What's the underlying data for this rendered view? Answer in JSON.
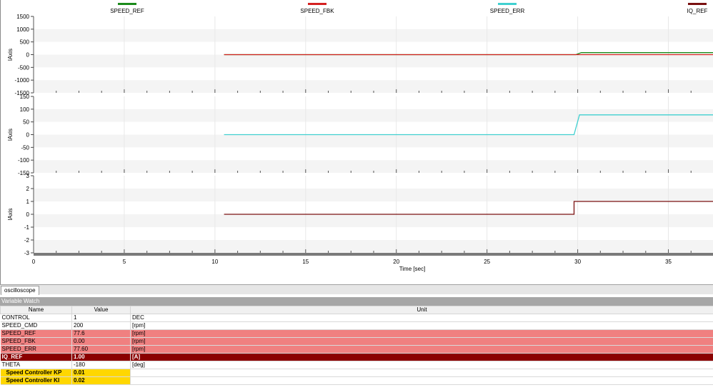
{
  "legend": [
    {
      "name": "SPEED_REF",
      "color": "#1a8a1a"
    },
    {
      "name": "SPEED_FBK",
      "color": "#d42020"
    },
    {
      "name": "SPEED_ERR",
      "color": "#40d0d0"
    },
    {
      "name": "IQ_REF",
      "color": "#7a1010"
    }
  ],
  "chart_data": [
    {
      "type": "line",
      "ylabel": "lAxis",
      "ylim": [
        -1500,
        1500
      ],
      "yticks": [
        "1500",
        "1000",
        "500",
        "0",
        "-500",
        "-1000",
        "-1500"
      ],
      "xlim": [
        0,
        37.5
      ],
      "series": [
        {
          "name": "SPEED_REF",
          "color": "#1a8a1a",
          "x": [
            10.5,
            29.9,
            30.2,
            37.5
          ],
          "y": [
            0,
            0,
            77.6,
            77.6
          ]
        },
        {
          "name": "SPEED_FBK",
          "color": "#d42020",
          "x": [
            10.5,
            37.5
          ],
          "y": [
            0,
            0
          ]
        }
      ]
    },
    {
      "type": "line",
      "ylabel": "lAxis",
      "ylim": [
        -150,
        150
      ],
      "yticks": [
        "150",
        "100",
        "50",
        "0",
        "-50",
        "-100",
        "-150"
      ],
      "xlim": [
        0,
        37.5
      ],
      "series": [
        {
          "name": "SPEED_ERR",
          "color": "#40d0d0",
          "x": [
            10.5,
            29.8,
            30.1,
            37.5
          ],
          "y": [
            0,
            0,
            77.6,
            77.6
          ]
        }
      ]
    },
    {
      "type": "line",
      "ylabel": "lAxis",
      "ylim": [
        -3,
        3
      ],
      "yticks": [
        "3",
        "2",
        "1",
        "0",
        "-1",
        "-2",
        "-3"
      ],
      "xlim": [
        0,
        37.5
      ],
      "xlabel": "Time [sec]",
      "xticks": [
        "0",
        "5",
        "10",
        "15",
        "20",
        "25",
        "30",
        "35"
      ],
      "series": [
        {
          "name": "IQ_REF",
          "color": "#7a1010",
          "x": [
            10.5,
            29.8,
            29.8,
            37.5
          ],
          "y": [
            0,
            0,
            1,
            1
          ]
        }
      ]
    }
  ],
  "tabs": {
    "oscilloscope": "oscilloscope"
  },
  "watch": {
    "title": "Variable Watch",
    "headers": {
      "name": "Name",
      "value": "Value",
      "unit": "Unit"
    },
    "rows": [
      {
        "name": "CONTROL",
        "value": "1",
        "unit": "DEC"
      },
      {
        "name": "SPEED_CMD",
        "value": "200",
        "unit": "[rpm]"
      },
      {
        "name": "SPEED_REF",
        "value": "77.6",
        "unit": "[rpm]"
      },
      {
        "name": "SPEED_FBK",
        "value": "0.00",
        "unit": "[rpm]"
      },
      {
        "name": "SPEED_ERR",
        "value": "77.60",
        "unit": "[rpm]"
      },
      {
        "name": "IQ_REF",
        "value": "1.00",
        "unit": "[A]"
      },
      {
        "name": "THETA",
        "value": "-180",
        "unit": "[deg]"
      },
      {
        "name": "Speed Controller KP",
        "value": "0.01",
        "unit": ""
      },
      {
        "name": "Speed Controller KI",
        "value": "0.02",
        "unit": ""
      }
    ]
  }
}
